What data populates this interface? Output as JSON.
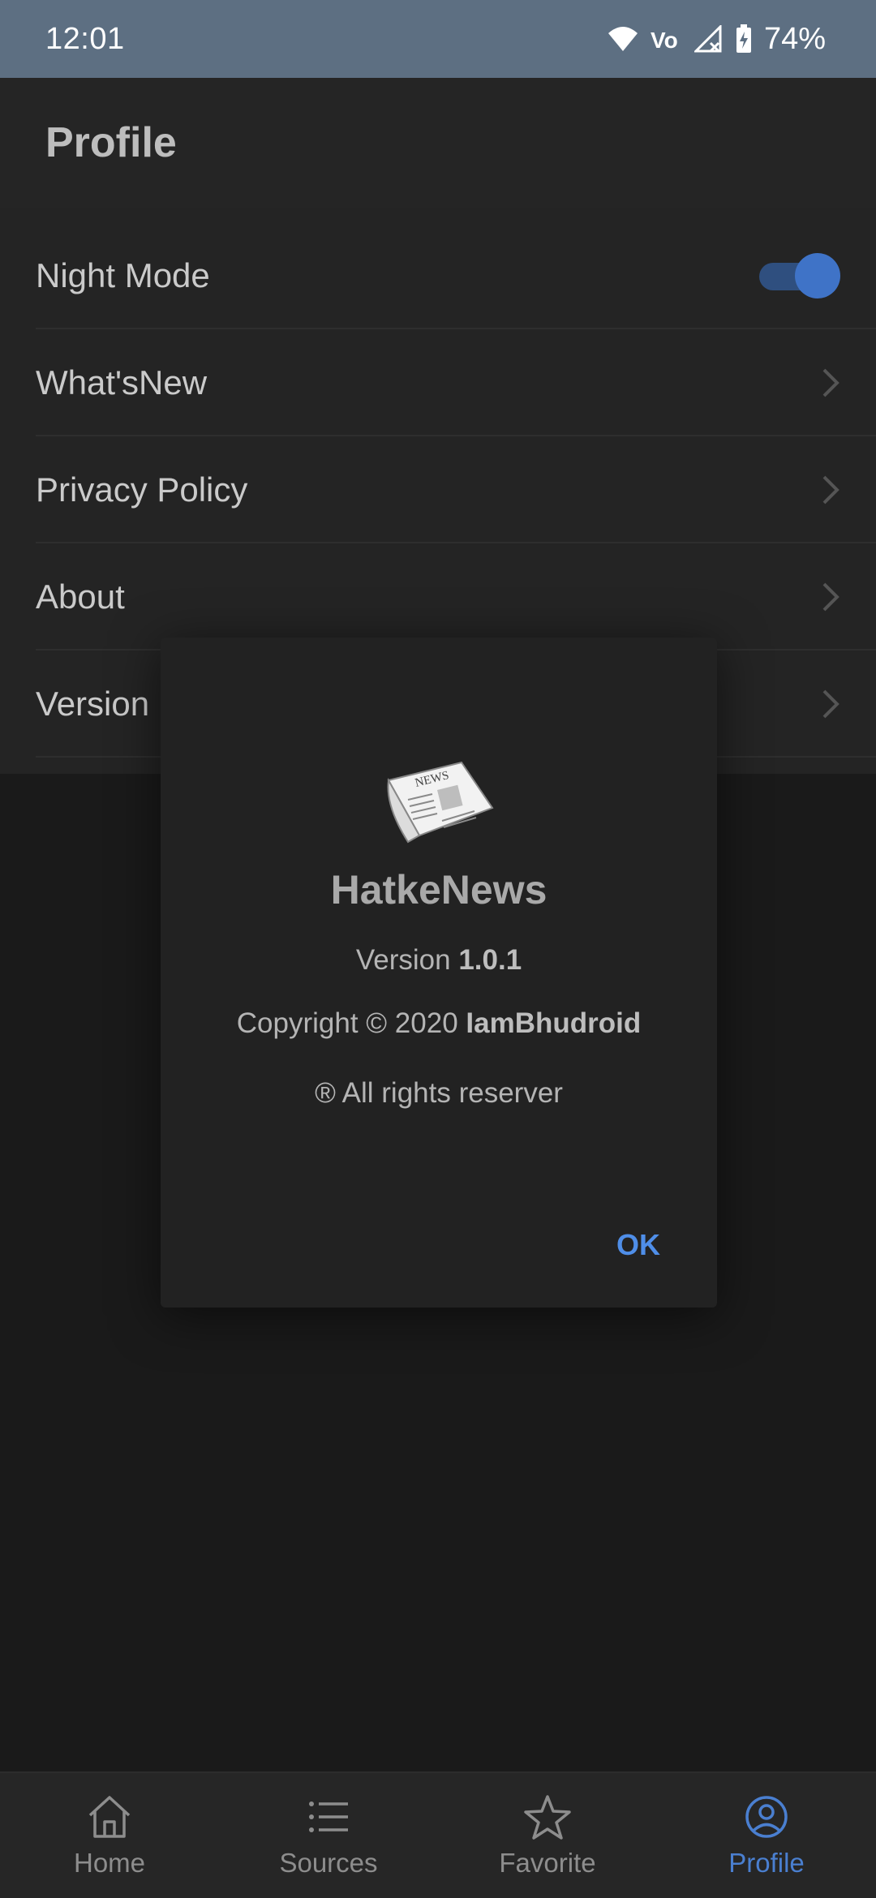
{
  "status_bar": {
    "time": "12:01",
    "battery": "74%",
    "network": "Vo"
  },
  "app_bar": {
    "title": "Profile"
  },
  "settings": {
    "night_mode": {
      "label": "Night Mode",
      "enabled": true
    },
    "items": [
      {
        "label": "What'sNew"
      },
      {
        "label": "Privacy Policy"
      },
      {
        "label": "About"
      },
      {
        "label": "Version"
      }
    ]
  },
  "dialog": {
    "app_name": "HatkeNews",
    "version_prefix": "Version",
    "version": "1.0.1",
    "copyright_prefix": "Copyright © 2020",
    "author": "IamBhudroid",
    "rights": "® All rights reserver",
    "ok_label": "OK",
    "logo_text": "NEWS"
  },
  "bottom_nav": {
    "items": [
      {
        "label": "Home",
        "icon": "home-icon",
        "active": false
      },
      {
        "label": "Sources",
        "icon": "list-icon",
        "active": false
      },
      {
        "label": "Favorite",
        "icon": "star-icon",
        "active": false
      },
      {
        "label": "Profile",
        "icon": "profile-icon",
        "active": true
      }
    ]
  },
  "colors": {
    "status_bar": "#5d6f82",
    "accent": "#4a7fd0",
    "background": "#1a1a1a",
    "surface": "#242424"
  }
}
